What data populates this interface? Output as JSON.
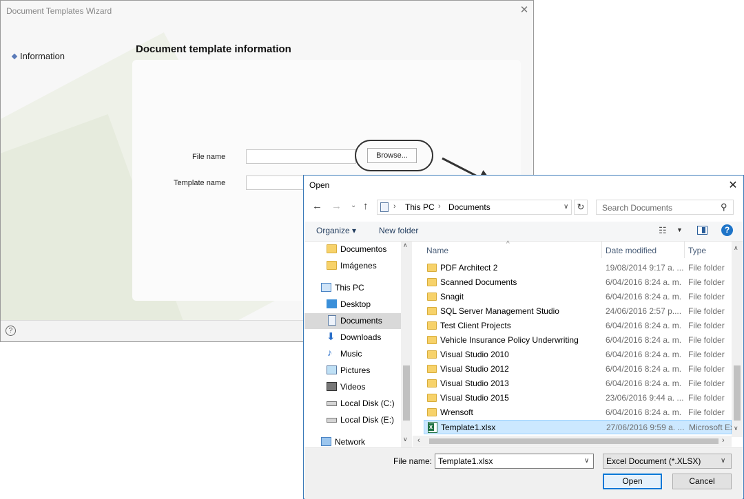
{
  "wizard": {
    "title": "Document Templates Wizard",
    "nav_item": "Information",
    "heading": "Document template information",
    "file_name_label": "File name",
    "template_name_label": "Template name",
    "file_name_value": "",
    "template_name_value": "",
    "browse_label": "Browse...",
    "close_glyph": "✕",
    "help_glyph": "?"
  },
  "open_dialog": {
    "title": "Open",
    "close_glyph": "✕",
    "address": {
      "segments": [
        "This PC",
        "Documents"
      ]
    },
    "search_placeholder": "Search Documents",
    "toolbar": {
      "organize": "Organize ▾",
      "new_folder": "New folder",
      "help": "?"
    },
    "nav_items": [
      {
        "label": "Documentos",
        "icon": "folder-icon"
      },
      {
        "label": "Imágenes",
        "icon": "folder-icon"
      },
      {
        "label": "This PC",
        "icon": "computer-icon"
      },
      {
        "label": "Desktop",
        "icon": "desktop-icon"
      },
      {
        "label": "Documents",
        "icon": "documents-icon",
        "selected": true
      },
      {
        "label": "Downloads",
        "icon": "download-icon"
      },
      {
        "label": "Music",
        "icon": "music-icon"
      },
      {
        "label": "Pictures",
        "icon": "pictures-icon"
      },
      {
        "label": "Videos",
        "icon": "videos-icon"
      },
      {
        "label": "Local Disk (C:)",
        "icon": "disk-icon"
      },
      {
        "label": "Local Disk (E:)",
        "icon": "disk-icon"
      },
      {
        "label": "Network",
        "icon": "network-icon"
      }
    ],
    "columns": {
      "name": "Name",
      "date": "Date modified",
      "type": "Type"
    },
    "files": [
      {
        "name": "PDF Architect 2",
        "date": "19/08/2014 9:17 a. ...",
        "type": "File folder",
        "icon": "folder-icon"
      },
      {
        "name": "Scanned Documents",
        "date": "6/04/2016 8:24 a. m.",
        "type": "File folder",
        "icon": "folder-icon"
      },
      {
        "name": "Snagit",
        "date": "6/04/2016 8:24 a. m.",
        "type": "File folder",
        "icon": "folder-icon"
      },
      {
        "name": "SQL Server Management Studio",
        "date": "24/06/2016 2:57 p....",
        "type": "File folder",
        "icon": "folder-icon"
      },
      {
        "name": "Test Client Projects",
        "date": "6/04/2016 8:24 a. m.",
        "type": "File folder",
        "icon": "folder-icon"
      },
      {
        "name": "Vehicle Insurance Policy Underwriting",
        "date": "6/04/2016 8:24 a. m.",
        "type": "File folder",
        "icon": "folder-icon"
      },
      {
        "name": "Visual Studio 2010",
        "date": "6/04/2016 8:24 a. m.",
        "type": "File folder",
        "icon": "folder-icon"
      },
      {
        "name": "Visual Studio 2012",
        "date": "6/04/2016 8:24 a. m.",
        "type": "File folder",
        "icon": "folder-icon"
      },
      {
        "name": "Visual Studio 2013",
        "date": "6/04/2016 8:24 a. m.",
        "type": "File folder",
        "icon": "folder-icon"
      },
      {
        "name": "Visual Studio 2015",
        "date": "23/06/2016 9:44 a. ...",
        "type": "File folder",
        "icon": "folder-icon"
      },
      {
        "name": "Wrensoft",
        "date": "6/04/2016 8:24 a. m.",
        "type": "File folder",
        "icon": "folder-icon"
      },
      {
        "name": "Template1.xlsx",
        "date": "27/06/2016 9:59 a. ...",
        "type": "Microsoft Excel Worksheet",
        "icon": "excel-icon",
        "selected": true
      }
    ],
    "file_name_label": "File name:",
    "file_name_value": "Template1.xlsx",
    "file_type_value": "Excel Document (*.XLSX)",
    "open_label": "Open",
    "cancel_label": "Cancel"
  },
  "colors": {
    "accent": "#0078d7",
    "selection": "#cce8ff",
    "folder": "#f7d26a",
    "help": "#1e74c8"
  }
}
